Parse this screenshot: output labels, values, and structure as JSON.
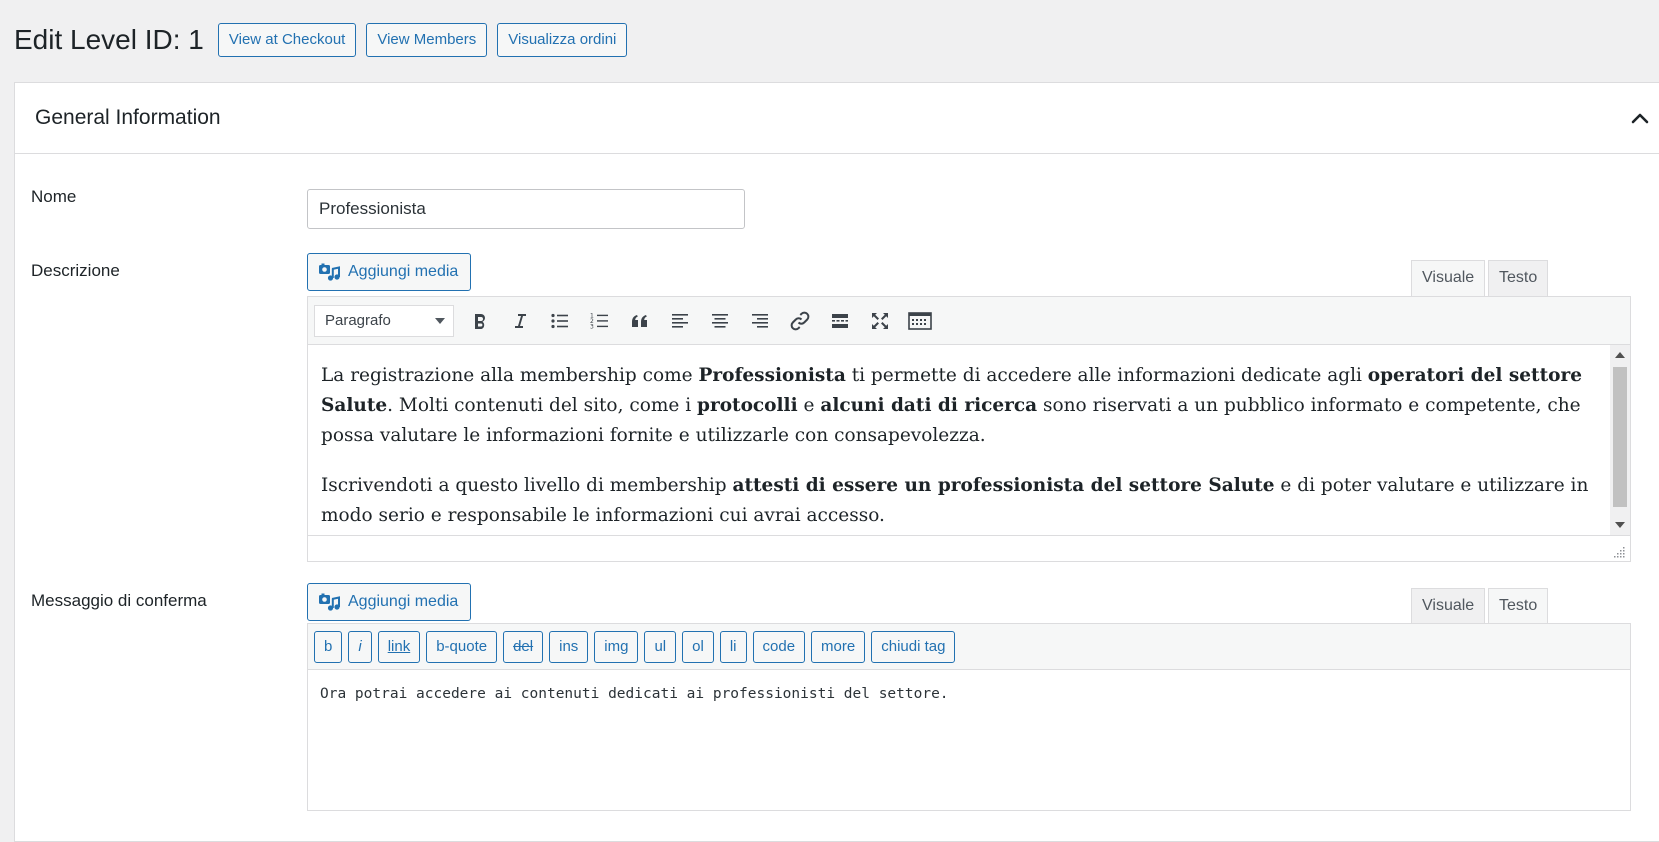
{
  "header": {
    "title": "Edit Level ID: 1",
    "buttons": [
      "View at Checkout",
      "View Members",
      "Visualizza ordini"
    ]
  },
  "panel": {
    "title": "General Information",
    "toggle_icon": "chevron-up-icon"
  },
  "name_field": {
    "label": "Nome",
    "value": "Professionista"
  },
  "description": {
    "label": "Descrizione",
    "add_media": "Aggiungi media",
    "tab_visual": "Visuale",
    "tab_text": "Testo",
    "active_tab": "Visuale",
    "format_select": "Paragrafo",
    "toolbar_icons": [
      "bold-icon",
      "italic-icon",
      "bulleted-list-icon",
      "numbered-list-icon",
      "blockquote-icon",
      "align-left-icon",
      "align-center-icon",
      "align-right-icon",
      "link-icon",
      "read-more-icon",
      "fullscreen-icon",
      "toolbar-toggle-icon"
    ],
    "paragraphs": [
      [
        {
          "t": "La registrazione alla membership come ",
          "b": false
        },
        {
          "t": "Professionista",
          "b": true
        },
        {
          "t": " ti permette di accedere alle informazioni dedicate agli ",
          "b": false
        },
        {
          "t": "operatori del settore Salute",
          "b": true
        },
        {
          "t": ". Molti contenuti del sito, come i ",
          "b": false
        },
        {
          "t": "protocolli",
          "b": true
        },
        {
          "t": " e ",
          "b": false
        },
        {
          "t": "alcuni dati di ricerca",
          "b": true
        },
        {
          "t": " sono riservati a un pubblico informato e competente, che possa valutare le informazioni fornite e utilizzarle con consapevolezza.",
          "b": false
        }
      ],
      [
        {
          "t": "Iscrivendoti a questo livello di membership ",
          "b": false
        },
        {
          "t": "attesti di essere un professionista del settore Salute",
          "b": true
        },
        {
          "t": " e di poter valutare e utilizzare in modo serio e responsabile le informazioni cui avrai accesso.",
          "b": false
        }
      ]
    ]
  },
  "confirmation": {
    "label": "Messaggio di conferma",
    "add_media": "Aggiungi media",
    "tab_visual": "Visuale",
    "tab_text": "Testo",
    "active_tab": "Testo",
    "quicktags": [
      "b",
      "i",
      "link",
      "b-quote",
      "del",
      "ins",
      "img",
      "ul",
      "ol",
      "li",
      "code",
      "more",
      "chiudi tag"
    ],
    "text": "Ora potrai accedere ai contenuti dedicati ai professionisti del settore."
  },
  "colors": {
    "accent": "#2271b1",
    "background": "#f0f0f1",
    "border": "#dcdcde"
  }
}
